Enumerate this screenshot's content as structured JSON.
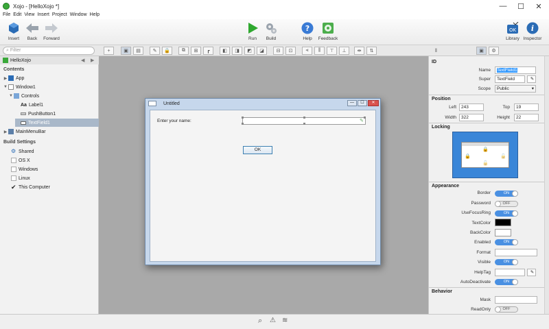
{
  "window": {
    "title": "Xojo - [HelloXojo *]",
    "min": "—",
    "max": "☐",
    "close": "✕"
  },
  "menu": [
    "File",
    "Edit",
    "View",
    "Insert",
    "Project",
    "Window",
    "Help"
  ],
  "toolbar": {
    "insert": "Insert",
    "back": "Back",
    "forward": "Forward",
    "run": "Run",
    "build": "Build",
    "help": "Help",
    "feedback": "Feedback",
    "library": "Library",
    "inspector": "Inspector"
  },
  "filter": {
    "placeholder": "Filter"
  },
  "navigator": {
    "project": "HelloXojo",
    "contents_header": "Contents",
    "items": [
      {
        "label": "App",
        "icon": "app-icon"
      },
      {
        "label": "Window1",
        "icon": "window-icon"
      },
      {
        "label": "Controls",
        "icon": "controls-icon"
      },
      {
        "label": "Label1",
        "icon": "label-icon"
      },
      {
        "label": "PushButton1",
        "icon": "pushbutton-icon"
      },
      {
        "label": "TextField1",
        "icon": "textfield-icon"
      },
      {
        "label": "MainMenuBar",
        "icon": "menubar-icon"
      }
    ],
    "build_header": "Build Settings",
    "build_items": [
      {
        "label": "Shared",
        "checked": false
      },
      {
        "label": "OS X",
        "checked": false
      },
      {
        "label": "Windows",
        "checked": false
      },
      {
        "label": "Linux",
        "checked": false
      },
      {
        "label": "This Computer",
        "checked": true
      }
    ]
  },
  "dialog": {
    "title": "Untitled",
    "label": "Enter your name:",
    "button": "OK"
  },
  "inspector": {
    "id_header": "ID",
    "name_label": "Name",
    "name_value": "TextField1",
    "super_label": "Super",
    "super_value": "TextField",
    "scope_label": "Scope",
    "scope_value": "Public",
    "position_header": "Position",
    "left_label": "Left",
    "left_value": "243",
    "top_label": "Top",
    "top_value": "19",
    "width_label": "Width",
    "width_value": "322",
    "height_label": "Height",
    "height_value": "22",
    "locking_header": "Locking",
    "appearance_header": "Appearance",
    "border_label": "Border",
    "border_value": "ON",
    "password_label": "Password",
    "password_value": "OFF",
    "usefocusring_label": "UseFocusRing",
    "usefocusring_value": "ON",
    "textcolor_label": "TextColor",
    "textcolor_value": "#000000",
    "backcolor_label": "BackColor",
    "backcolor_value": "#FFFFFF",
    "enabled_label": "Enabled",
    "enabled_value": "ON",
    "format_label": "Format",
    "visible_label": "Visible",
    "visible_value": "ON",
    "helptag_label": "HelpTag",
    "autodeactivate_label": "AutoDeactivate",
    "autodeactivate_value": "ON",
    "behavior_header": "Behavior",
    "mask_label": "Mask",
    "readonly_label": "ReadOnly",
    "readonly_value": "OFF"
  }
}
